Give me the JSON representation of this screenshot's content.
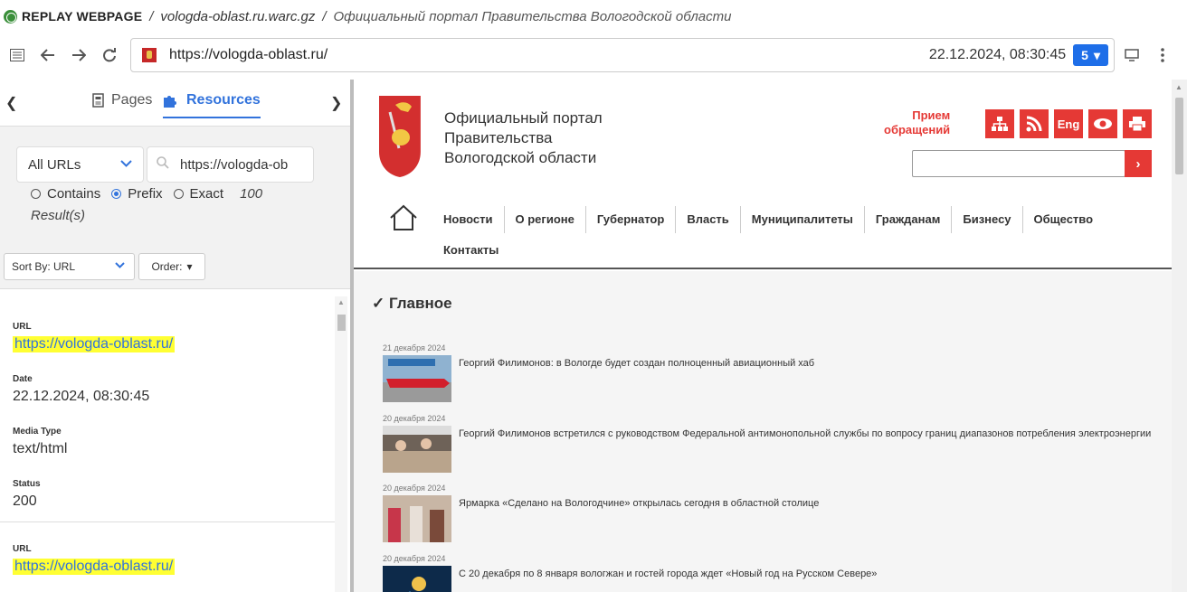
{
  "titlebar": {
    "brand": "REPLAY WEBPAGE",
    "separator": "/",
    "archive": "vologda-oblast.ru.warc.gz",
    "page_title": "Официальный портал Правительства Вологодской области"
  },
  "toolbar": {
    "url": "https://vologda-oblast.ru/",
    "timestamp": "22.12.2024, 08:30:45",
    "capture_count": "5",
    "icons": [
      "list-icon",
      "back-arrow-icon",
      "forward-arrow-icon",
      "reload-icon",
      "screen-icon",
      "kebab-menu-icon"
    ]
  },
  "sidebar": {
    "tabs": {
      "pages": "Pages",
      "resources": "Resources"
    },
    "filter": {
      "url_scope": "All URLs",
      "search_value": "https://vologda-ob",
      "radios": {
        "contains": "Contains",
        "prefix": "Prefix",
        "exact": "Exact"
      },
      "selected_radio": "Prefix",
      "count": "100",
      "results_label": "Result(s)"
    },
    "sort": {
      "sort_by": "Sort By: URL",
      "order": "Order:"
    },
    "results": [
      {
        "url_label": "URL",
        "url": "https://vologda-oblast.ru/",
        "date_label": "Date",
        "date": "22.12.2024, 08:30:45",
        "media_label": "Media Type",
        "media": "text/html",
        "status_label": "Status",
        "status": "200"
      },
      {
        "url_label": "URL",
        "url": "https://vologda-oblast.ru/"
      }
    ]
  },
  "page": {
    "site_title_1": "Официальный портал",
    "site_title_2": "Правительства",
    "site_title_3": "Вологодской области",
    "priem_1": "Прием",
    "priem_2": "обращений",
    "eng_label": "Eng",
    "menu_row1": [
      "Новости",
      "О регионе",
      "Губернатор",
      "Власть",
      "Муниципалитеты",
      "Гражданам",
      "Бизнесу",
      "Общество"
    ],
    "menu_row2": [
      "Контакты"
    ],
    "section_title": "✓ Главное",
    "news": [
      {
        "date": "21 декабря 2024",
        "title": "Георгий Филимонов: в Вологде будет создан полноценный авиационный хаб"
      },
      {
        "date": "20 декабря 2024",
        "title": "Георгий Филимонов встретился с руководством Федеральной антимонопольной службы по вопросу границ диапазонов потребления электроэнергии"
      },
      {
        "date": "20 декабря 2024",
        "title": "Ярмарка «Сделано на Вологодчине» открылась сегодня в областной столице"
      },
      {
        "date": "20 декабря 2024",
        "title": "С 20 декабря по 8 января вологжан и гостей города ждет «Новый год на Русском Севере»"
      }
    ]
  },
  "colors": {
    "accent": "#3273dc",
    "gov_red": "#e53935",
    "highlight": "#ffff33"
  }
}
